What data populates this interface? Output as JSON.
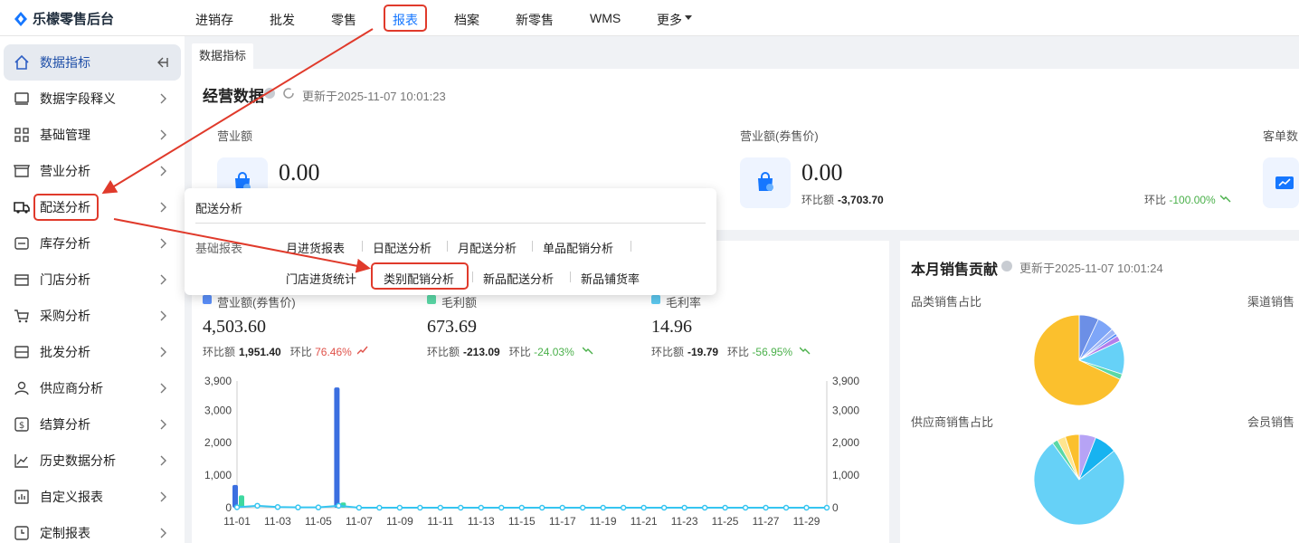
{
  "app": {
    "name": "乐檬零售后台"
  },
  "topnav": {
    "items": [
      "进销存",
      "批发",
      "零售",
      "报表",
      "档案",
      "新零售",
      "WMS",
      "更多"
    ],
    "active": "报表"
  },
  "sidebar": {
    "items": [
      {
        "label": "数据指标",
        "icon": "home-icon",
        "active": true
      },
      {
        "label": "数据字段释义",
        "icon": "monitor-icon"
      },
      {
        "label": "基础管理",
        "icon": "grid-icon"
      },
      {
        "label": "营业分析",
        "icon": "store-icon"
      },
      {
        "label": "配送分析",
        "icon": "truck-icon"
      },
      {
        "label": "库存分析",
        "icon": "inventory-icon"
      },
      {
        "label": "门店分析",
        "icon": "shop-icon"
      },
      {
        "label": "采购分析",
        "icon": "cart-icon"
      },
      {
        "label": "批发分析",
        "icon": "wholesale-icon"
      },
      {
        "label": "供应商分析",
        "icon": "person-icon"
      },
      {
        "label": "结算分析",
        "icon": "dollar-icon"
      },
      {
        "label": "历史数据分析",
        "icon": "trend-icon"
      },
      {
        "label": "自定义报表",
        "icon": "bar-chart-icon"
      },
      {
        "label": "定制报表",
        "icon": "clock-icon"
      }
    ]
  },
  "tabs": {
    "active": "数据指标"
  },
  "business": {
    "title": "经营数据",
    "updated": "更新于2025-11-07 10:01:23",
    "metrics": [
      {
        "label": "营业额",
        "value": "0.00"
      },
      {
        "label": "营业额(券售价)",
        "value": "0.00",
        "cmp_label": "环比额",
        "cmp_value": "-3,703.70",
        "pct_label": "环比",
        "pct_value": "-100.00%"
      },
      {
        "label": "客单数"
      }
    ]
  },
  "popup": {
    "title": "配送分析",
    "category": "基础报表",
    "links": [
      "月进货报表",
      "日配送分析",
      "月配送分析",
      "单品配销分析",
      "门店进货统计",
      "类别配销分析",
      "新品配送分析",
      "新品铺货率"
    ],
    "highlighted": "类别配销分析"
  },
  "sales": {
    "metrics": [
      {
        "label": "营业额(券售价)",
        "value": "4,503.60",
        "cmp_label": "环比额",
        "cmp_value": "1,951.40",
        "pct_label": "环比",
        "pct_value": "76.46%",
        "trend": "up",
        "color": "#5b8ff9"
      },
      {
        "label": "毛利额",
        "value": "673.69",
        "cmp_label": "环比额",
        "cmp_value": "-213.09",
        "pct_label": "环比",
        "pct_value": "-24.03%",
        "trend": "down",
        "color": "#5ad8a6"
      },
      {
        "label": "毛利率",
        "value": "14.96",
        "cmp_label": "环比额",
        "cmp_value": "-19.79",
        "pct_label": "环比",
        "pct_value": "-56.95%",
        "trend": "down",
        "color": "#5dc8ef"
      }
    ]
  },
  "chart_data": {
    "type": "bar",
    "x": [
      "11-01",
      "11-02",
      "11-03",
      "11-04",
      "11-05",
      "11-06",
      "11-07",
      "11-08",
      "11-09",
      "11-10",
      "11-11",
      "11-12",
      "11-13",
      "11-14",
      "11-15",
      "11-16",
      "11-17",
      "11-18",
      "11-19",
      "11-20",
      "11-21",
      "11-22",
      "11-23",
      "11-24",
      "11-25",
      "11-26",
      "11-27",
      "11-28",
      "11-29",
      "11-30"
    ],
    "xticks": [
      "11-01",
      "11-03",
      "11-05",
      "11-07",
      "11-09",
      "11-11",
      "11-13",
      "11-15",
      "11-17",
      "11-19",
      "11-21",
      "11-23",
      "11-25",
      "11-27",
      "11-29"
    ],
    "yticks": [
      "3,900",
      "3,000",
      "2,000",
      "1,000",
      "0"
    ],
    "ylim": [
      0,
      3900
    ],
    "series": [
      {
        "name": "营业额(券售价)",
        "kind": "bar",
        "color": "#3b6fe0",
        "values": [
          700,
          0,
          0,
          0,
          0,
          3700,
          0,
          0,
          0,
          0,
          0,
          0,
          0,
          0,
          0,
          0,
          0,
          0,
          0,
          0,
          0,
          0,
          0,
          0,
          0,
          0,
          0,
          0,
          0,
          0
        ]
      },
      {
        "name": "毛利额",
        "kind": "bar",
        "color": "#3ed8a0",
        "values": [
          380,
          0,
          0,
          0,
          0,
          160,
          0,
          0,
          0,
          0,
          0,
          0,
          0,
          0,
          0,
          0,
          0,
          0,
          0,
          0,
          0,
          0,
          0,
          0,
          0,
          0,
          0,
          0,
          0,
          0
        ]
      },
      {
        "name": "毛利率",
        "kind": "line",
        "color": "#36c5f0",
        "values": [
          15,
          60,
          20,
          10,
          10,
          60,
          0,
          0,
          0,
          0,
          0,
          0,
          0,
          0,
          0,
          0,
          0,
          0,
          0,
          0,
          0,
          0,
          0,
          0,
          0,
          0,
          0,
          0,
          0,
          0
        ]
      }
    ]
  },
  "monthly": {
    "title": "本月销售贡献",
    "updated": "更新于2025-11-07 10:01:24",
    "category_label": "品类销售占比",
    "channel_label": "渠道销售",
    "supplier_label": "供应商销售占比",
    "member_label": "会员销售",
    "pie_category": [
      {
        "value": 68,
        "color": "#fbc02d"
      },
      {
        "value": 2,
        "color": "#5ad8a6"
      },
      {
        "value": 12,
        "color": "#66d1f7"
      },
      {
        "value": 2,
        "color": "#b37feb"
      },
      {
        "value": 1,
        "color": "#5b8ff9"
      },
      {
        "value": 2,
        "color": "#9db5f6"
      },
      {
        "value": 6,
        "color": "#7ea6f8"
      },
      {
        "value": 7,
        "color": "#6c8fe6"
      }
    ],
    "pie_supplier": [
      {
        "value": 6,
        "color": "#b6a3f5"
      },
      {
        "value": 8,
        "color": "#17b3f0"
      },
      {
        "value": 76,
        "color": "#66d1f7"
      },
      {
        "value": 2,
        "color": "#5ad8a6"
      },
      {
        "value": 3,
        "color": "#ffe58f"
      },
      {
        "value": 5,
        "color": "#fbc02d"
      }
    ]
  }
}
